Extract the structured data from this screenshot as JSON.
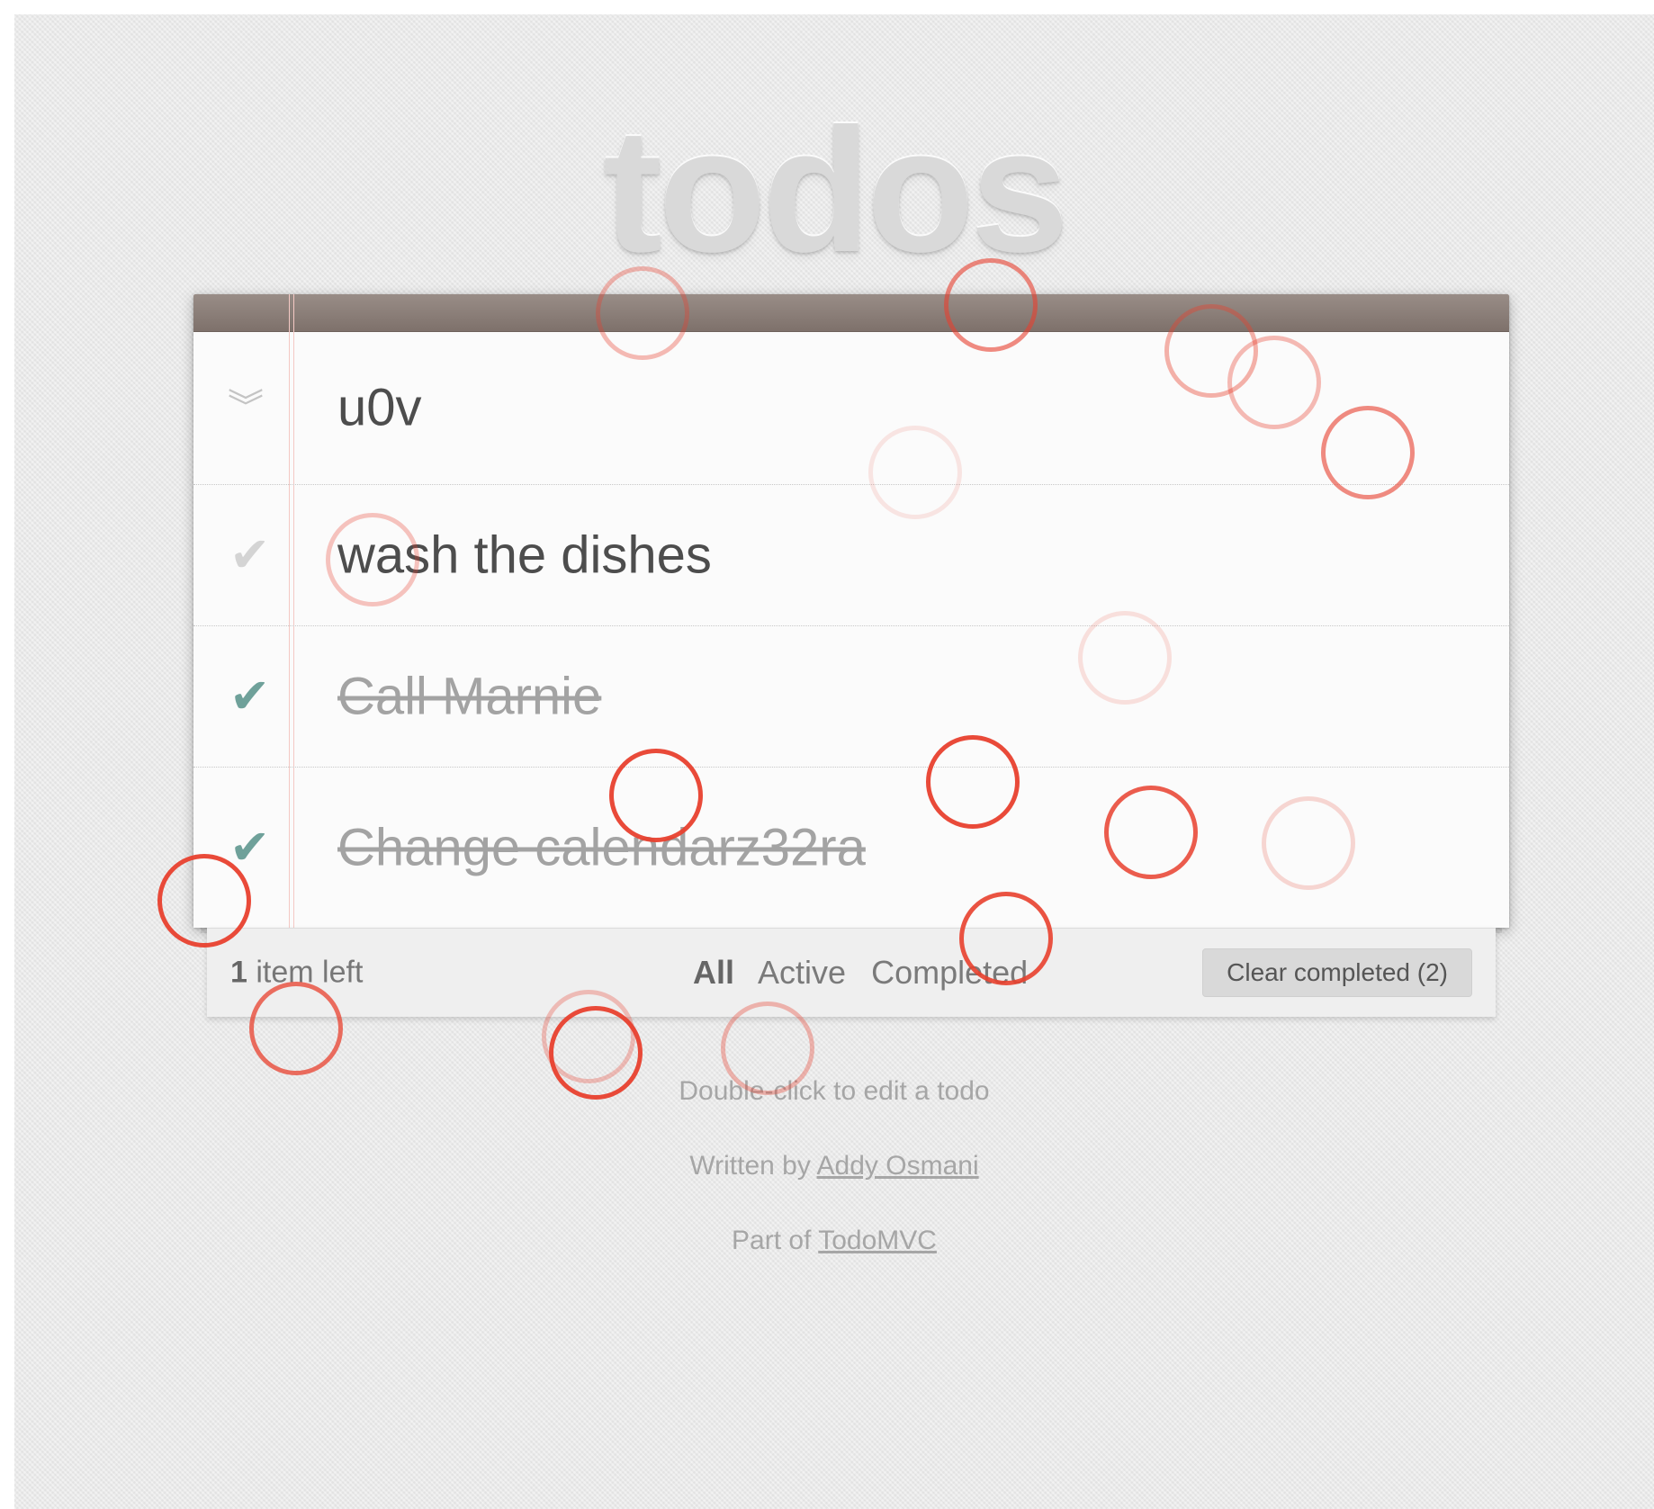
{
  "app": {
    "title": "todos"
  },
  "todos": {
    "new_todo_value": "u0v",
    "items": [
      {
        "label": "wash the dishes",
        "completed": false
      },
      {
        "label": "Call Marnie",
        "completed": true
      },
      {
        "label": "Change calendarz32ra",
        "completed": true
      }
    ]
  },
  "footer": {
    "count": "1",
    "count_suffix": " item left",
    "filters": [
      "All",
      "Active",
      "Completed"
    ],
    "selected_filter": "All",
    "clear_completed_label": "Clear completed (2)"
  },
  "info": {
    "hint": "Double-click to edit a todo",
    "written_by_prefix": "Written by ",
    "author": "Addy Osmani",
    "part_of_prefix": "Part of ",
    "project": "TodoMVC"
  },
  "icons": {
    "toggle_all": "double-chevron-down-icon",
    "check": "checkmark-icon"
  },
  "colors": {
    "header_bar": "#7e716b",
    "check_completed": "#6fa19a",
    "check_incomplete": "#d4d4d4",
    "click_marker": "#e8402e"
  }
}
